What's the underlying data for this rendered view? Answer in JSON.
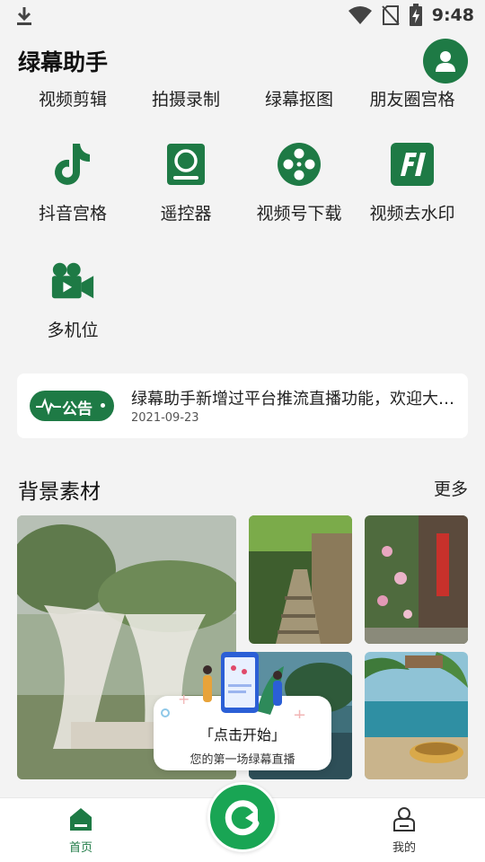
{
  "status_bar": {
    "time": "9:48"
  },
  "header": {
    "title": "绿幕助手"
  },
  "top_links": [
    "视频剪辑",
    "拍摄录制",
    "绿幕抠图",
    "朋友圈宫格"
  ],
  "grid": [
    {
      "label": "抖音宫格",
      "icon": "tiktok-icon"
    },
    {
      "label": "遥控器",
      "icon": "remote-icon"
    },
    {
      "label": "视频号下载",
      "icon": "film-reel-icon"
    },
    {
      "label": "视频去水印",
      "icon": "watermark-icon"
    },
    {
      "label": "多机位",
      "icon": "video-camera-icon"
    }
  ],
  "notice": {
    "badge": "公告",
    "text": "绿幕助手新增过平台推流直播功能，欢迎大家体验",
    "date": "2021-09-23"
  },
  "materials": {
    "title": "背景素材",
    "more": "更多"
  },
  "popup": {
    "title": "「点击开始」",
    "subtitle": "您的第一场绿幕直播"
  },
  "bottom_nav": {
    "home": "首页",
    "me": "我的"
  },
  "colors": {
    "brand_green": "#1e7a45",
    "fab_green": "#19a554",
    "background": "#f3f3f3"
  }
}
